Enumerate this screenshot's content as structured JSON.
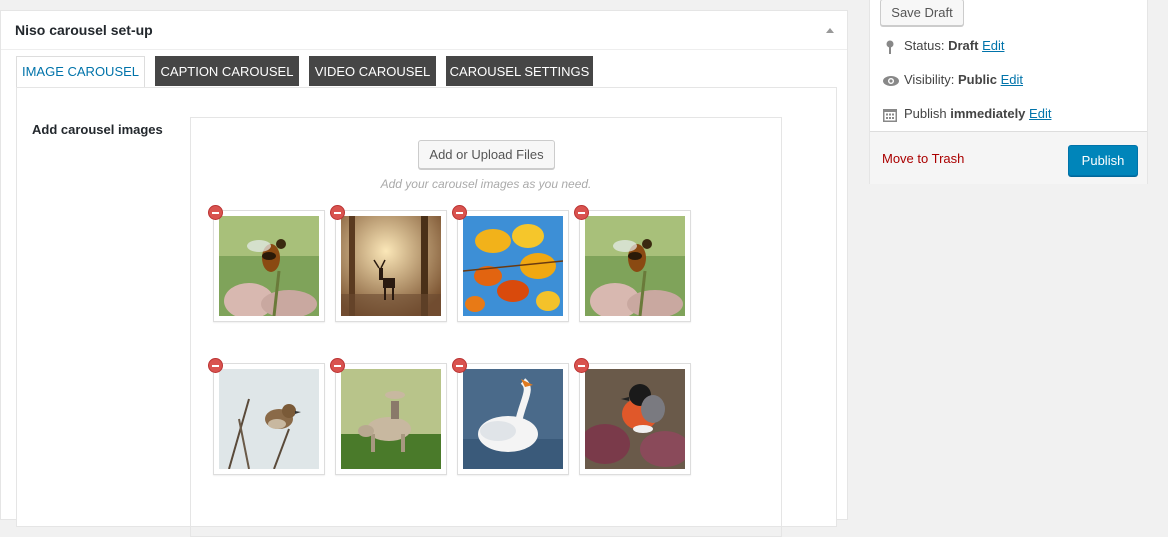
{
  "metabox": {
    "title": "Niso carousel set-up",
    "tabs": [
      {
        "label": "IMAGE CAROUSEL",
        "active": true
      },
      {
        "label": "CAPTION CAROUSEL",
        "active": false
      },
      {
        "label": "VIDEO CAROUSEL",
        "active": false
      },
      {
        "label": "CAROUSEL SETTINGS",
        "active": false
      }
    ],
    "field_label": "Add carousel images",
    "upload_button": "Add or Upload Files",
    "hint": "Add your carousel images as you need.",
    "images": [
      {
        "subject": "bee on flower"
      },
      {
        "subject": "deer in misty forest"
      },
      {
        "subject": "autumn leaves"
      },
      {
        "subject": "bee on flower"
      },
      {
        "subject": "sparrow on branch"
      },
      {
        "subject": "boy riding ox"
      },
      {
        "subject": "white swan"
      },
      {
        "subject": "bullfinch bird"
      }
    ]
  },
  "publish": {
    "save_draft": "Save Draft",
    "status_label": "Status:",
    "status_value": "Draft",
    "visibility_label": "Visibility:",
    "visibility_value": "Public",
    "publish_label": "Publish",
    "publish_value": "immediately",
    "edit": "Edit",
    "trash": "Move to Trash",
    "publish_button": "Publish"
  },
  "colors": {
    "accent": "#0073aa",
    "publish_button": "#0085ba",
    "trash": "#a00000",
    "tab_inactive": "#464646"
  }
}
